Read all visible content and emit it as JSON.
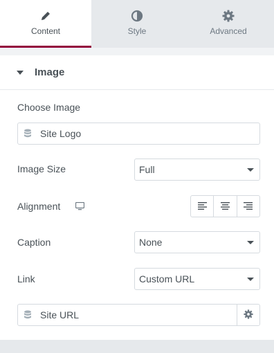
{
  "tabs": [
    {
      "label": "Content",
      "icon": "pencil-icon",
      "active": true
    },
    {
      "label": "Style",
      "icon": "half-circle-icon",
      "active": false
    },
    {
      "label": "Advanced",
      "icon": "gear-icon",
      "active": false
    }
  ],
  "section": {
    "title": "Image",
    "icon": "caret-down-icon"
  },
  "fields": {
    "choose_image": {
      "label": "Choose Image",
      "value": "Site Logo",
      "icon": "database-icon"
    },
    "image_size": {
      "label": "Image Size",
      "value": "Full"
    },
    "alignment": {
      "label": "Alignment",
      "device_icon": "desktop-icon",
      "options": [
        "left",
        "center",
        "right"
      ]
    },
    "caption": {
      "label": "Caption",
      "value": "None"
    },
    "link": {
      "label": "Link",
      "value": "Custom URL"
    },
    "site_url": {
      "value": "Site URL",
      "icon": "database-icon",
      "action_icon": "gear-icon"
    }
  },
  "colors": {
    "accent": "#93003c",
    "text": "#495157",
    "border": "#d5dadf"
  }
}
